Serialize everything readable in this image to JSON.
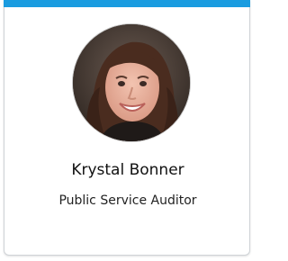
{
  "card": {
    "accent_color": "#1a9ce0",
    "border_color": "#cfd3d7",
    "avatar_icon": "profile-photo",
    "name": "Krystal Bonner",
    "job_title": "Public Service Auditor"
  }
}
